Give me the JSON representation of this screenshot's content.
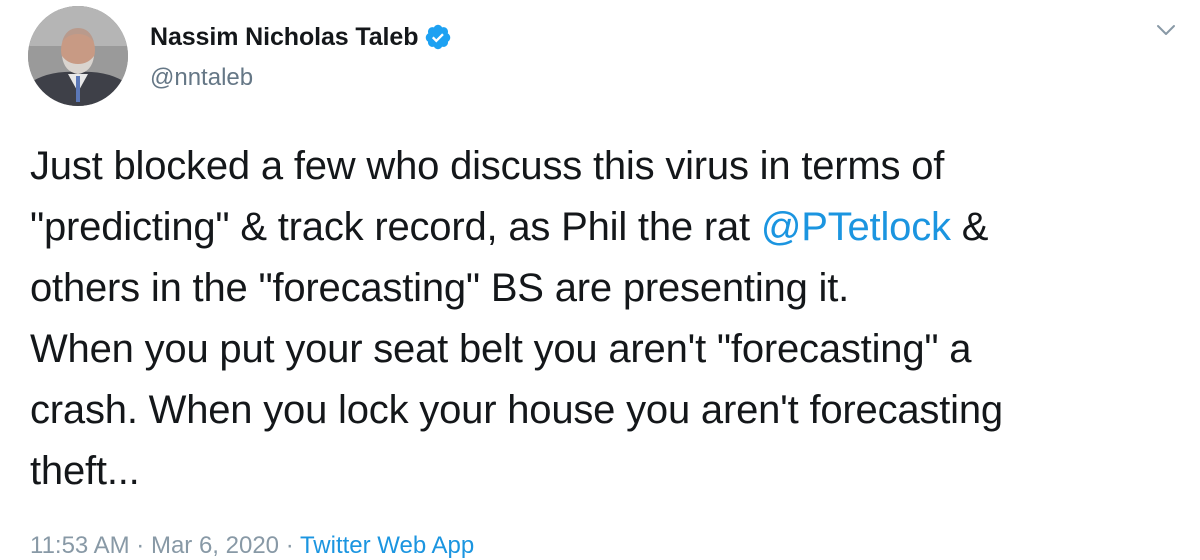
{
  "author": {
    "display_name": "Nassim Nicholas Taleb",
    "handle": "@nntaleb",
    "verified_icon": "verified-badge-icon",
    "avatar_icon": "profile-photo"
  },
  "menu": {
    "icon": "chevron-down-icon"
  },
  "tweet": {
    "line1": "Just blocked a few who discuss this virus in terms of",
    "line2_before": "\"predicting\" & track record, as Phil the rat ",
    "line2_mention": "@PTetlock",
    "line2_after": " &",
    "line3": "others in the \"forecasting\" BS are presenting it.",
    "line4": "When you put your seat belt you aren't \"forecasting\" a",
    "line5": "crash. When you lock your house you aren't forecasting",
    "line6": "theft..."
  },
  "meta": {
    "time": "11:53 AM",
    "separator1": " · ",
    "date": "Mar 6, 2020",
    "separator2": " · ",
    "source": "Twitter Web App"
  },
  "colors": {
    "link": "#1b95e0",
    "text": "#14171a",
    "secondary": "#657786"
  }
}
